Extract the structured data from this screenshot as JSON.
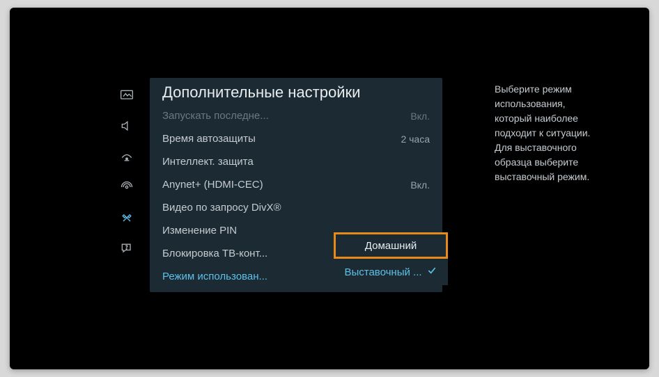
{
  "panel": {
    "title": "Дополнительные настройки"
  },
  "settings": [
    {
      "label": "Запускать последне...",
      "value": "Вкл.",
      "dim": true
    },
    {
      "label": "Время автозащиты",
      "value": "2 часа"
    },
    {
      "label": "Интеллект. защита",
      "value": ""
    },
    {
      "label": "Anynet+ (HDMI-CEC)",
      "value": "Вкл."
    },
    {
      "label": "Видео по запросу DivX®",
      "value": ""
    },
    {
      "label": "Изменение PIN",
      "value": ""
    },
    {
      "label": "Блокировка ТВ-конт...",
      "value": ""
    },
    {
      "label": "Режим использован...",
      "value": "",
      "highlight": true
    }
  ],
  "popup": {
    "options": [
      {
        "label": "Домашний",
        "selected": true
      },
      {
        "label": "Выставочный ...",
        "checked": true
      }
    ]
  },
  "help": "Выберите режим использования, который наиболее подходит к ситуации. Для выставочного образца выберите выставочный режим."
}
